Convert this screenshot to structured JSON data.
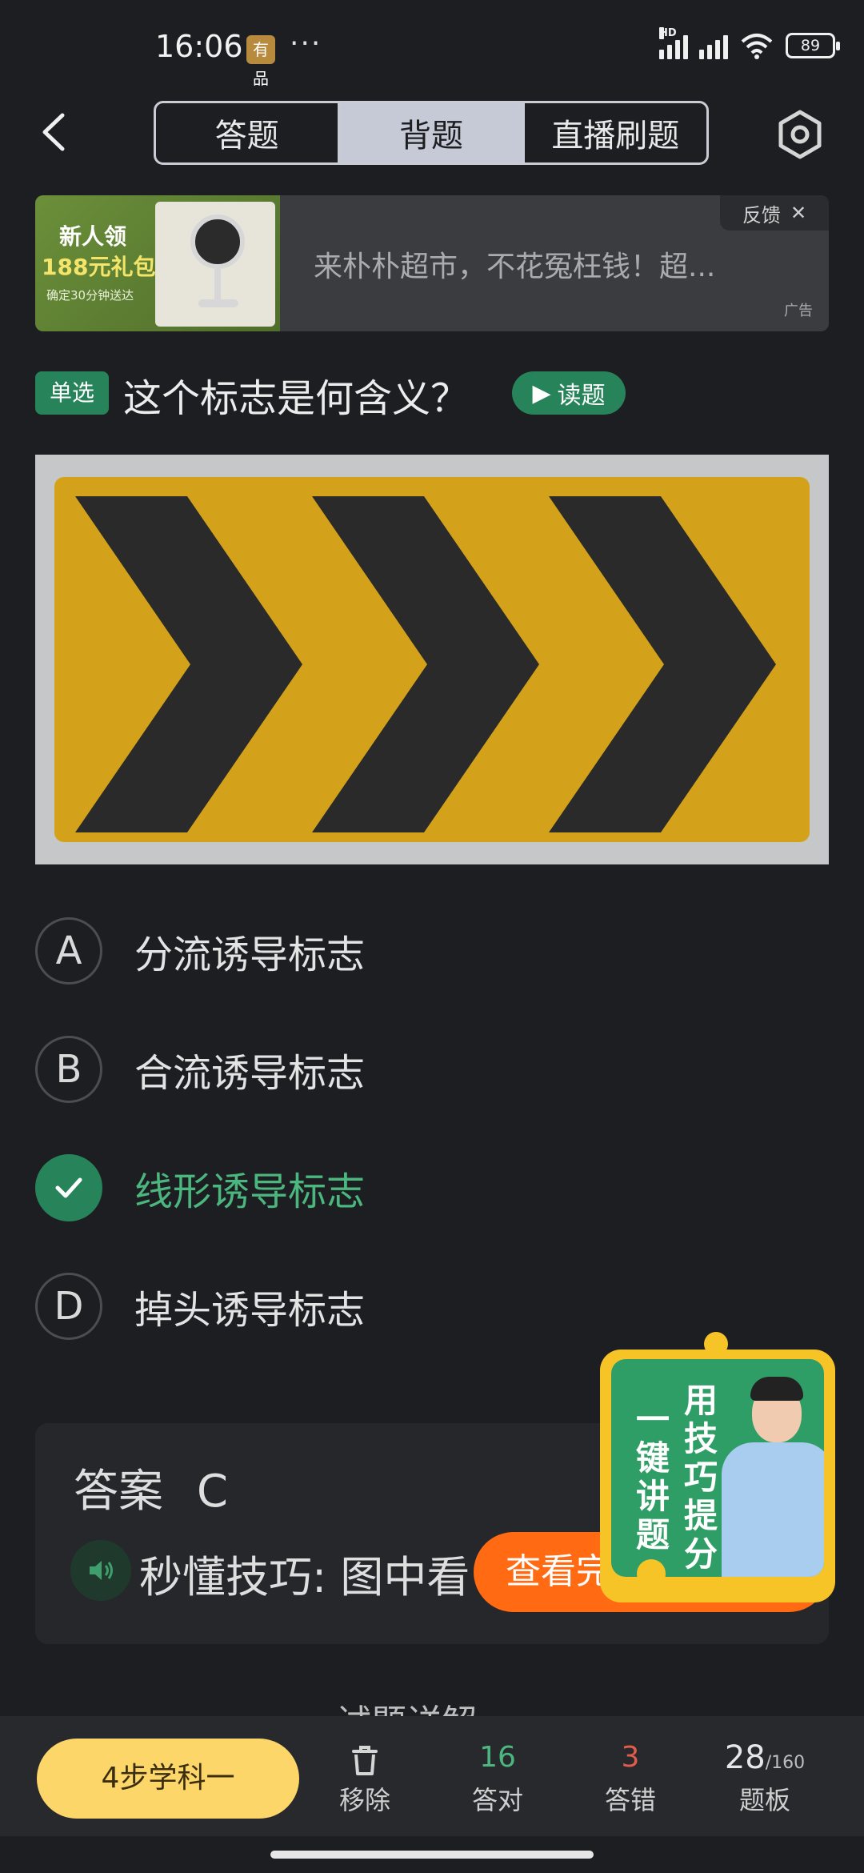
{
  "status": {
    "time": "16:06",
    "badge": "有品",
    "dots": "···",
    "network": "HD",
    "battery": "89"
  },
  "nav": {
    "tabs": [
      {
        "label": "答题",
        "active": false
      },
      {
        "label": "背题",
        "active": true
      },
      {
        "label": "直播刷题",
        "active": false
      }
    ]
  },
  "ad": {
    "image_line1": "新人领",
    "image_line2": "188元礼包",
    "image_line3": "确定30分钟送达",
    "text": "来朴朴超市，不花冤枉钱！超...",
    "feedback": "反馈",
    "label": "广告"
  },
  "question": {
    "type": "单选",
    "text": "这个标志是何含义？",
    "read_button": "读题"
  },
  "options": [
    {
      "letter": "A",
      "text": "分流诱导标志",
      "correct": false
    },
    {
      "letter": "B",
      "text": "合流诱导标志",
      "correct": false
    },
    {
      "letter": "C",
      "text": "线形诱导标志",
      "correct": true
    },
    {
      "letter": "D",
      "text": "掉头诱导标志",
      "correct": false
    }
  ],
  "answer": {
    "label": "答案",
    "value": "C",
    "tip": "秒懂技巧: 图中看",
    "see_full": "查看完"
  },
  "promo": {
    "col1": "一键讲题",
    "col2": "用技巧提分"
  },
  "section_peek": "试题详解",
  "bottom": {
    "steps_button": "4步学科一",
    "remove": {
      "icon": "trash-icon",
      "label": "移除"
    },
    "correct": {
      "count": "16",
      "label": "答对",
      "color": "#4bb77f"
    },
    "wrong": {
      "count": "3",
      "label": "答错",
      "color": "#e25c4b"
    },
    "board": {
      "current": "28",
      "total": "/160",
      "label": "题板"
    }
  },
  "colors": {
    "accent_green": "#27845a",
    "orange": "#ff6a12",
    "sign_yellow": "#d3a21a"
  }
}
